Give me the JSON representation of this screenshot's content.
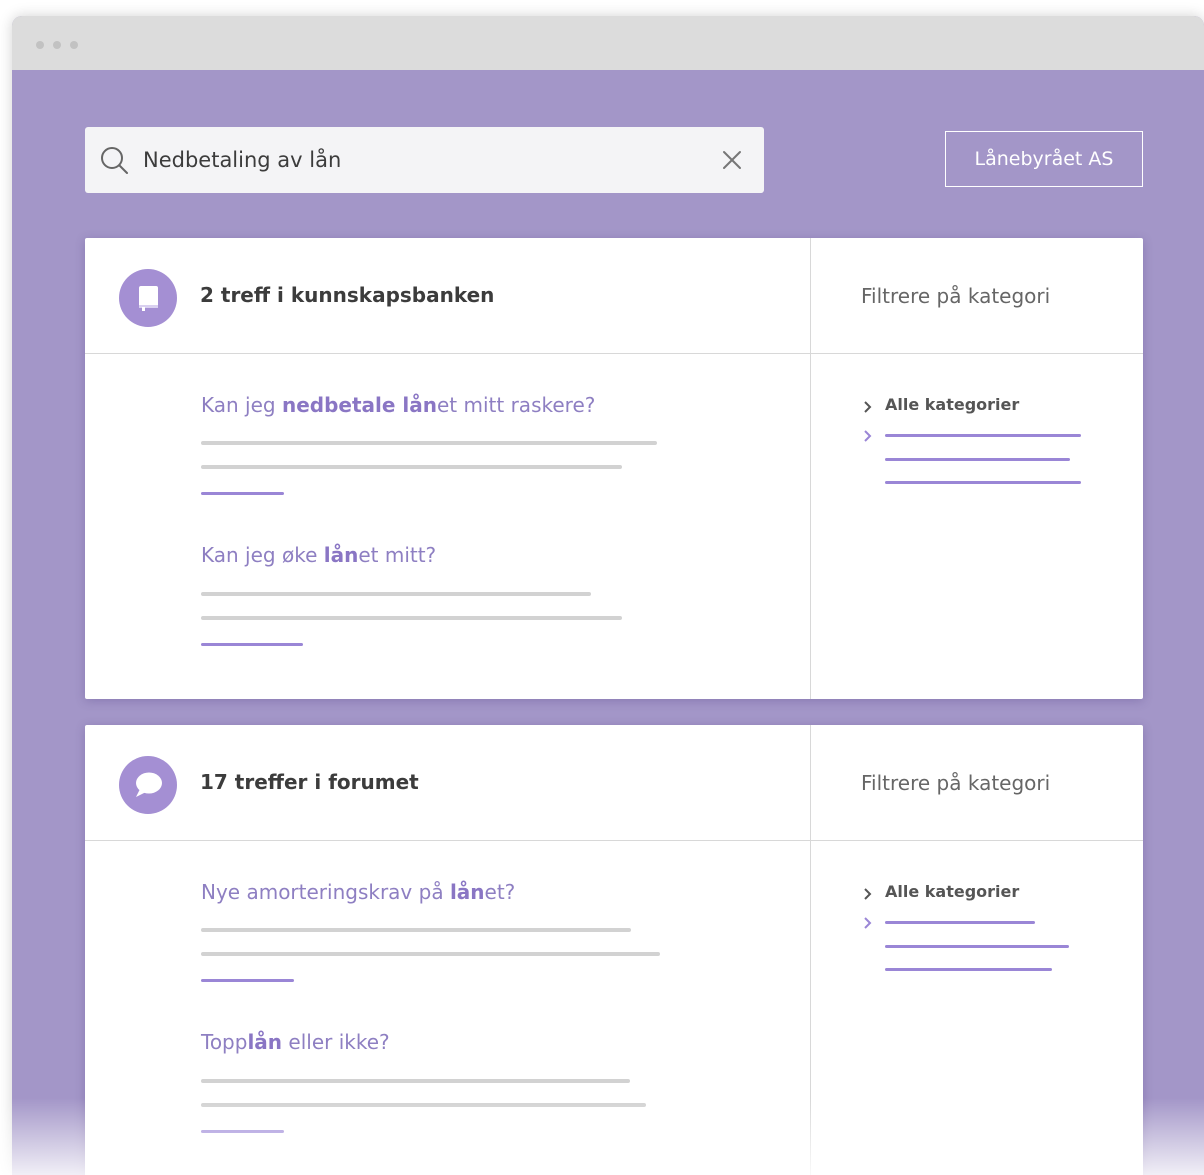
{
  "search": {
    "value": "Nedbetaling av lån",
    "icon": "search-icon",
    "clear_icon": "close-icon"
  },
  "header": {
    "org_button_label": "Lånebyrået AS"
  },
  "colors": {
    "background": "#a396c8",
    "accent": "#9a86d6",
    "badge": "#a48fd3",
    "link": "#8e7fc2"
  },
  "sections": [
    {
      "icon": "book-icon",
      "title": "2 treff i kunnskapsbanken",
      "filter_label": "Filtrere på kategori",
      "category_label": "Alle kategorier",
      "results": [
        {
          "parts": [
            "Kan jeg ",
            "nedbetale lån",
            "et mitt raskere?"
          ]
        },
        {
          "parts": [
            "Kan jeg øke ",
            "lån",
            "et mitt?"
          ]
        }
      ]
    },
    {
      "icon": "chat-bubble-icon",
      "title": "17 treffer i forumet",
      "filter_label": "Filtrere på kategori",
      "category_label": "Alle kategorier",
      "results": [
        {
          "parts": [
            "Nye amorteringskrav på ",
            "lån",
            "et?"
          ]
        },
        {
          "parts": [
            "Topp",
            "lån",
            " eller ikke?"
          ]
        }
      ]
    }
  ]
}
